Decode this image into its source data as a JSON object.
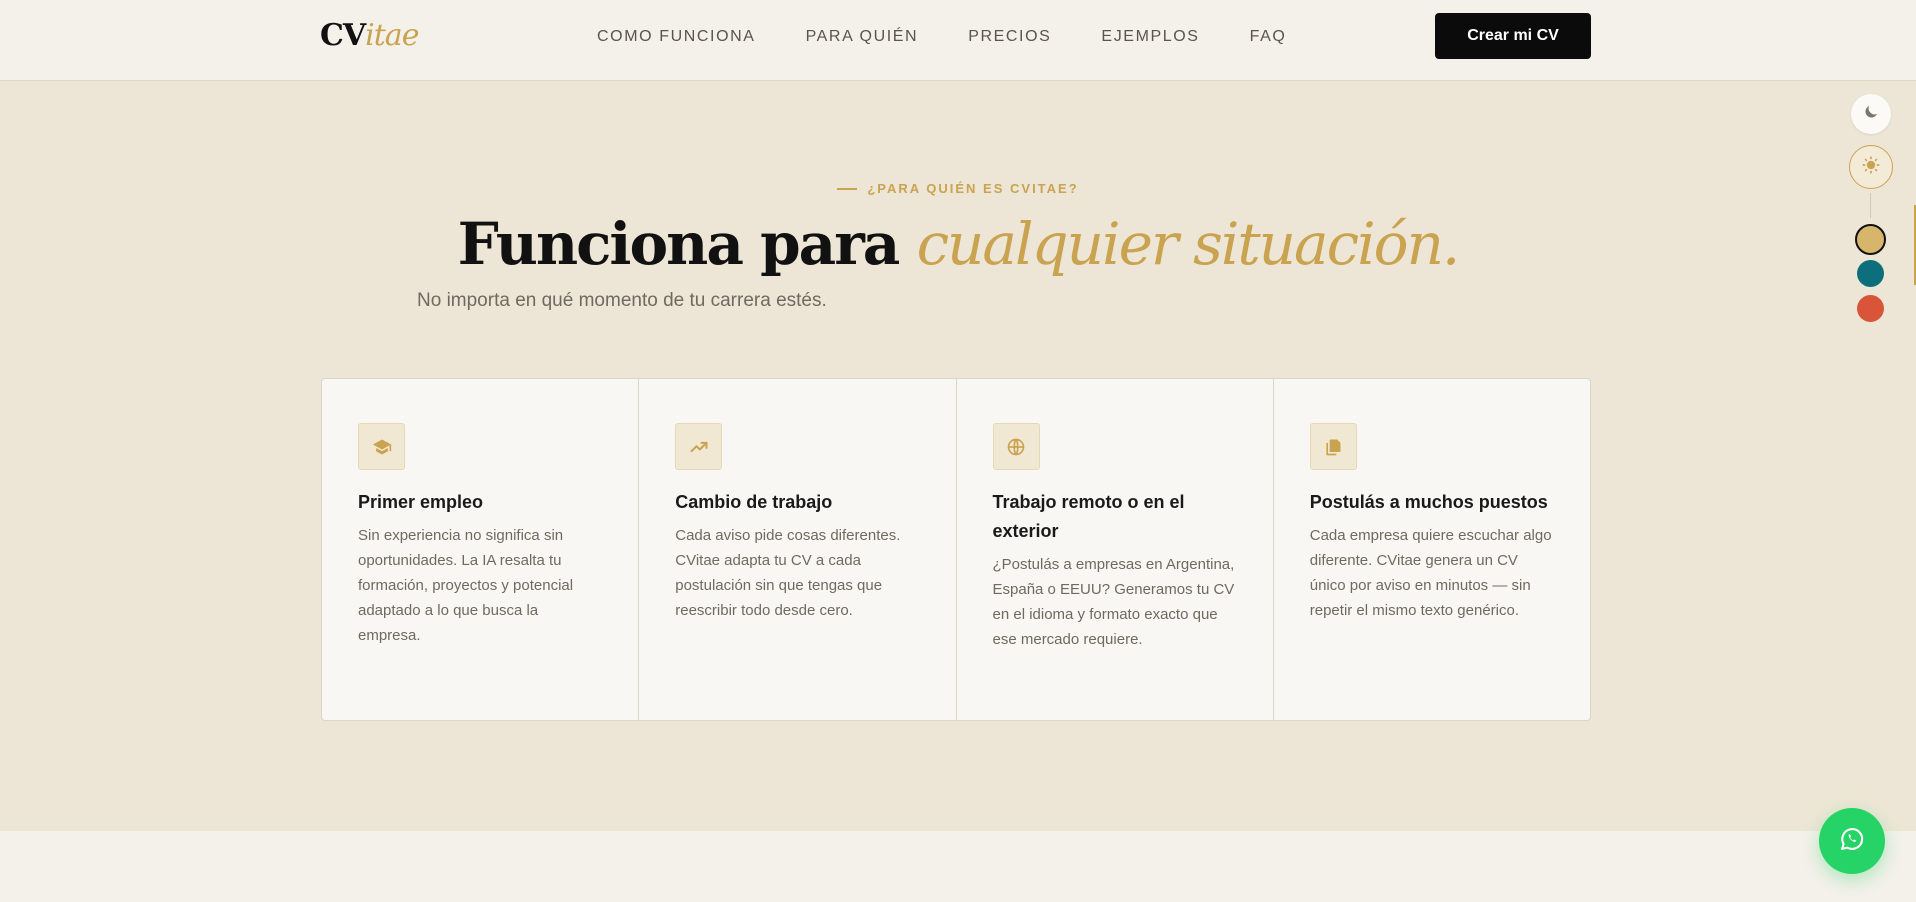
{
  "header": {
    "logo_main": "CV",
    "logo_accent": "itae",
    "nav": [
      "COMO FUNCIONA",
      "PARA QUIÉN",
      "PRECIOS",
      "EJEMPLOS",
      "FAQ"
    ],
    "cta_label": "Crear mi CV"
  },
  "hero": {
    "eyebrow": "¿PARA QUIÉN ES CVITAE?",
    "title_plain": "Funciona para",
    "title_accent": "cualquier situación.",
    "subtitle": "No importa en qué momento de tu carrera estés."
  },
  "cards": [
    {
      "icon": "graduation-cap-icon",
      "title": "Primer empleo",
      "text": "Sin experiencia no significa sin oportunidades. La IA resalta tu formación, proyectos y potencial adaptado a lo que busca la empresa."
    },
    {
      "icon": "trending-up-icon",
      "title": "Cambio de trabajo",
      "text": "Cada aviso pide cosas diferentes. CVitae adapta tu CV a cada postulación sin que tengas que reescribir todo desde cero."
    },
    {
      "icon": "globe-icon",
      "title": "Trabajo remoto o en el exterior",
      "text": "¿Postulás a empresas en Argentina, España o EEUU? Generamos tu CV en el idioma y formato exacto que ese mercado requiere."
    },
    {
      "icon": "copy-icon",
      "title": "Postulás a muchos puestos",
      "text": "Cada empresa quiere escuchar algo diferente. CVitae genera un CV único por aviso en minutos — sin repetir el mismo texto genérico."
    }
  ],
  "theme_controls": {
    "icons": [
      "moon-icon",
      "sun-icon"
    ],
    "accent_colors": [
      "#d7b66b",
      "#0d6f7c",
      "#d9553a"
    ]
  },
  "colors": {
    "accent": "#c9a34f",
    "background": "#ede6d6",
    "whatsapp": "#25d366"
  },
  "whatsapp": {
    "icon": "whatsapp-icon"
  }
}
